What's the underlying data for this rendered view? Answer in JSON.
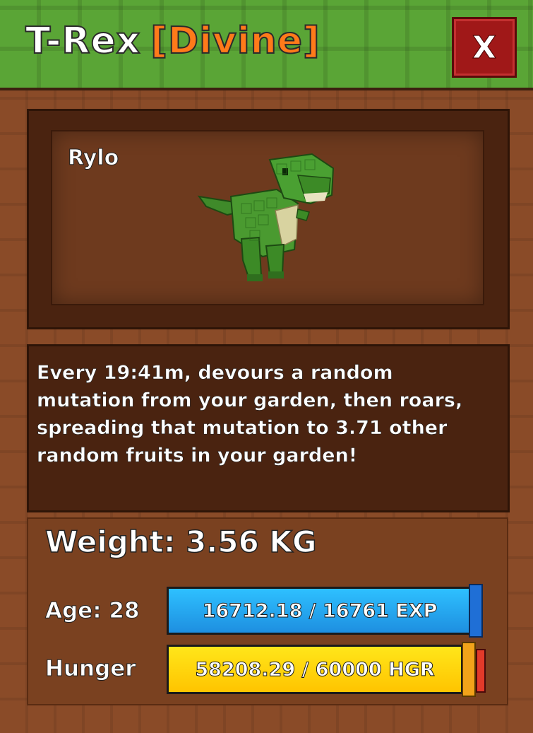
{
  "header": {
    "pet_type": "T-Rex",
    "rarity": "[Divine]",
    "close_label": "X"
  },
  "preview": {
    "pet_name": "Rylo",
    "pet_icon": "t-rex-model"
  },
  "description": "Every 19:41m, devours a random mutation from your garden, then roars, spreading that mutation to 3.71 other random fruits in your garden!",
  "stats": {
    "weight_text": "Weight: 3.56 KG",
    "age_label": "Age: 28",
    "exp_text": "16712.18 / 16761 EXP",
    "exp_fraction": 0.997,
    "hunger_label": "Hunger",
    "hunger_text": "58208.29 / 60000 HGR",
    "hunger_fraction": 0.97
  },
  "colors": {
    "header_green": "#5aa536",
    "rarity_orange": "#ff7a1a",
    "close_red": "#a01818",
    "exp_blue": "#2ec0ff",
    "hunger_yellow": "#ffe61a"
  }
}
